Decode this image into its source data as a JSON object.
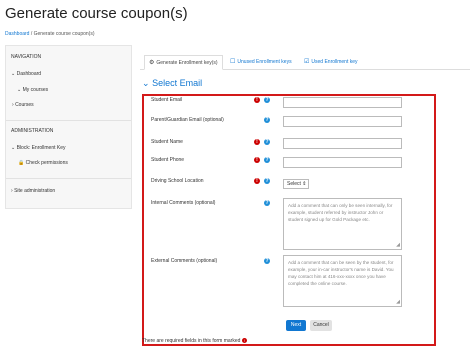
{
  "page_title": "Generate course coupon(s)",
  "breadcrumb": {
    "home": "Dashboard",
    "separator": "/",
    "current": "Generate course coupon(s)"
  },
  "sidebar": {
    "navigation_heading": "NAVIGATION",
    "dashboard": "Dashboard",
    "my_courses": "My courses",
    "courses": "Courses",
    "administration_heading": "ADMINISTRATION",
    "block_label": "Block: Enrollment Key",
    "check_permissions": "Check permissions",
    "site_admin": "Site administration"
  },
  "tabs": [
    {
      "label": "Generate Enrollment key(s)",
      "icon": "gear-icon"
    },
    {
      "label": "Unused Enrollment keys",
      "icon": "checkbox-icon"
    },
    {
      "label": "Used Enrollment key",
      "icon": "checkbox-checked-icon"
    }
  ],
  "section_title": "Select Email",
  "fields": {
    "student_email": "Student Email",
    "guardian_email": "Parent/Guardian Email (optional)",
    "student_name": "Student Name",
    "student_phone": "Student Phone",
    "location": "Driving School Location",
    "location_value": "Select",
    "internal_comments": "Internal Comments (optional)",
    "internal_placeholder": "Add a comment that can only be seen internally, for example, student referred by instructor John or student signed up for Gold Package etc.",
    "external_comments": "External Comments (optional)",
    "external_placeholder": "Add a comment that can be seen by the student, for example, your in-car instructor's name is David. You may contact him at 416-xxx-xxxx once you have completed the online course."
  },
  "buttons": {
    "next": "Next",
    "cancel": "Cancel"
  },
  "required_note": "There are required fields in this form marked",
  "colors": {
    "accent": "#1177d1",
    "required": "#cc0000",
    "highlight_border": "#d31919"
  }
}
